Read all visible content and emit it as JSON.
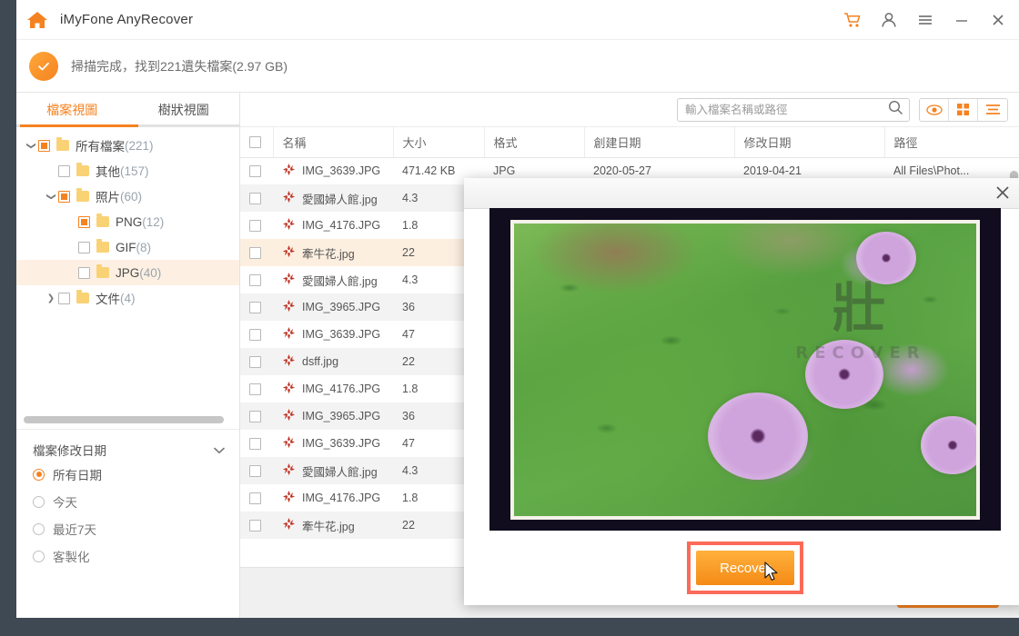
{
  "app": {
    "title": "iMyFone AnyRecover",
    "home_icon": "home-icon",
    "titlebar_icons": [
      {
        "name": "cart-icon",
        "glyph": "cart"
      },
      {
        "name": "account-icon",
        "glyph": "person"
      },
      {
        "name": "menu-icon",
        "glyph": "hamburger"
      },
      {
        "name": "minimize-icon",
        "glyph": "minus"
      },
      {
        "name": "close-icon",
        "glyph": "times"
      }
    ],
    "accent_color": "#f58220",
    "status": {
      "icon": "check-circle-icon",
      "text": "掃描完成，找到221遺失檔案(2.97 GB)"
    }
  },
  "sidebar": {
    "tabs": [
      {
        "label": "檔案視圖",
        "active": true
      },
      {
        "label": "樹狀視圖",
        "active": false
      }
    ],
    "tree": [
      {
        "label": "所有檔案",
        "count": "(221)",
        "indent": 0,
        "caret": "down",
        "check": "partial"
      },
      {
        "label": "其他",
        "count": "(157)",
        "indent": 1,
        "caret": "none",
        "check": "off"
      },
      {
        "label": "照片",
        "count": "(60)",
        "indent": 1,
        "caret": "down",
        "check": "partial"
      },
      {
        "label": "PNG",
        "count": "(12)",
        "indent": 2,
        "caret": "none",
        "check": "partial"
      },
      {
        "label": "GIF",
        "count": "(8)",
        "indent": 2,
        "caret": "none",
        "check": "off"
      },
      {
        "label": "JPG",
        "count": "(40)",
        "indent": 2,
        "caret": "none",
        "check": "off",
        "highlight": true
      },
      {
        "label": "文件",
        "count": "(4)",
        "indent": 1,
        "caret": "right",
        "check": "off"
      }
    ],
    "date_filter": {
      "title": "檔案修改日期",
      "chevron": "chevron-down-icon",
      "options": [
        {
          "label": "所有日期",
          "selected": true
        },
        {
          "label": "今天",
          "selected": false
        },
        {
          "label": "最近7天",
          "selected": false
        },
        {
          "label": "客製化",
          "selected": false
        }
      ]
    }
  },
  "toolbar": {
    "search_placeholder": "輸入檔案名稱或路徑",
    "search_value": "",
    "search_icon": "search-icon",
    "view_buttons": [
      {
        "name": "preview-eye-button",
        "icon": "eye-icon",
        "active": true
      },
      {
        "name": "grid-view-button",
        "icon": "grid-icon",
        "active": false
      },
      {
        "name": "list-view-button",
        "icon": "list-icon",
        "active": false
      }
    ]
  },
  "table": {
    "columns": [
      "名稱",
      "大小",
      "格式",
      "創建日期",
      "修改日期",
      "路徑"
    ],
    "rows": [
      {
        "name": "IMG_3639.JPG",
        "size": "471.42 KB",
        "format": "JPG",
        "created": "2020-05-27",
        "modified": "2019-04-21",
        "path": "All Files\\Phot...",
        "alt": false
      },
      {
        "name": "愛國婦人館.jpg",
        "size": "4.3",
        "format": "",
        "created": "",
        "modified": "",
        "path": "...",
        "alt": true
      },
      {
        "name": "IMG_4176.JPG",
        "size": "1.8",
        "format": "",
        "created": "",
        "modified": "",
        "path": "...",
        "alt": false
      },
      {
        "name": "牽牛花.jpg",
        "size": "22",
        "format": "",
        "created": "",
        "modified": "",
        "path": "...",
        "alt": false,
        "highlight": true
      },
      {
        "name": "愛國婦人館.jpg",
        "size": "4.3",
        "format": "",
        "created": "",
        "modified": "",
        "path": "...",
        "alt": false
      },
      {
        "name": "IMG_3965.JPG",
        "size": "36",
        "format": "",
        "created": "",
        "modified": "",
        "path": "...",
        "alt": true
      },
      {
        "name": "IMG_3639.JPG",
        "size": "47",
        "format": "",
        "created": "",
        "modified": "",
        "path": "...",
        "alt": false
      },
      {
        "name": "dsff.jpg",
        "size": "22",
        "format": "",
        "created": "",
        "modified": "",
        "path": "...",
        "alt": true
      },
      {
        "name": "IMG_4176.JPG",
        "size": "1.8",
        "format": "",
        "created": "",
        "modified": "",
        "path": "...",
        "alt": false
      },
      {
        "name": "IMG_3965.JPG",
        "size": "36",
        "format": "",
        "created": "",
        "modified": "",
        "path": "...",
        "alt": true
      },
      {
        "name": "IMG_3639.JPG",
        "size": "47",
        "format": "",
        "created": "",
        "modified": "",
        "path": "...",
        "alt": false
      },
      {
        "name": "愛國婦人館.jpg",
        "size": "4.3",
        "format": "",
        "created": "",
        "modified": "",
        "path": "...",
        "alt": true
      },
      {
        "name": "IMG_4176.JPG",
        "size": "1.8",
        "format": "",
        "created": "",
        "modified": "",
        "path": "...",
        "alt": false
      },
      {
        "name": "牽牛花.jpg",
        "size": "22",
        "format": "",
        "created": "",
        "modified": "",
        "path": "...",
        "alt": true
      }
    ]
  },
  "preview_modal": {
    "close_icon": "close-icon",
    "watermark_main": "壯",
    "watermark_sub": "RECOVER",
    "recover_label": "Recover"
  }
}
